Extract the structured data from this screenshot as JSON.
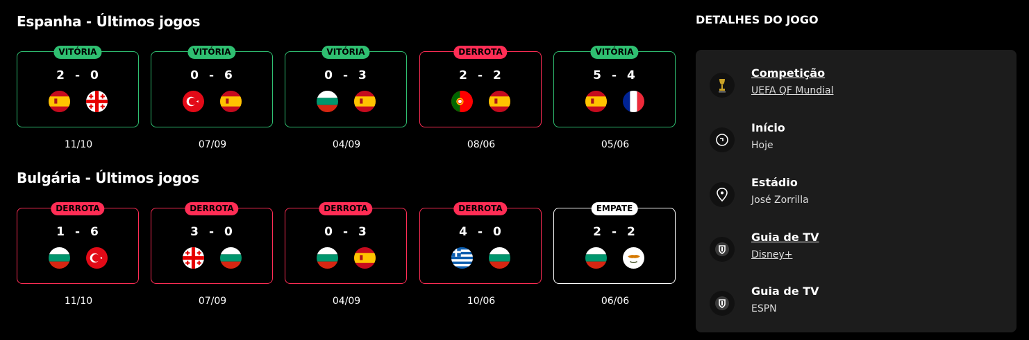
{
  "spain": {
    "title": "Espanha - Últimos jogos",
    "matches": [
      {
        "result": "VITÓRIA",
        "home": "2",
        "away": "0",
        "date": "11/10",
        "home_flag": "spain-flag-icon",
        "away_flag": "georgia-flag-icon"
      },
      {
        "result": "VITÓRIA",
        "home": "0",
        "away": "6",
        "date": "07/09",
        "home_flag": "turkey-flag-icon",
        "away_flag": "spain-flag-icon"
      },
      {
        "result": "VITÓRIA",
        "home": "0",
        "away": "3",
        "date": "04/09",
        "home_flag": "bulgaria-flag-icon",
        "away_flag": "spain-flag-icon"
      },
      {
        "result": "DERROTA",
        "home": "2",
        "away": "2",
        "date": "08/06",
        "home_flag": "portugal-flag-icon",
        "away_flag": "spain-flag-icon"
      },
      {
        "result": "VITÓRIA",
        "home": "5",
        "away": "4",
        "date": "05/06",
        "home_flag": "spain-flag-icon",
        "away_flag": "france-flag-icon"
      }
    ]
  },
  "bulgaria": {
    "title": "Bulgária - Últimos jogos",
    "matches": [
      {
        "result": "DERROTA",
        "home": "1",
        "away": "6",
        "date": "11/10",
        "home_flag": "bulgaria-flag-icon",
        "away_flag": "turkey-flag-icon"
      },
      {
        "result": "DERROTA",
        "home": "3",
        "away": "0",
        "date": "07/09",
        "home_flag": "georgia-flag-icon",
        "away_flag": "bulgaria-flag-icon"
      },
      {
        "result": "DERROTA",
        "home": "0",
        "away": "3",
        "date": "04/09",
        "home_flag": "bulgaria-flag-icon",
        "away_flag": "spain-flag-icon"
      },
      {
        "result": "DERROTA",
        "home": "4",
        "away": "0",
        "date": "10/06",
        "home_flag": "greece-flag-icon",
        "away_flag": "bulgaria-flag-icon"
      },
      {
        "result": "EMPATE",
        "home": "2",
        "away": "2",
        "date": "06/06",
        "home_flag": "bulgaria-flag-icon",
        "away_flag": "cyprus-flag-icon"
      }
    ]
  },
  "details": {
    "title": "DETALHES DO JOGO",
    "items": [
      {
        "label": "Competição",
        "value": "UEFA QF Mundial",
        "icon": "world-cup-trophy-icon"
      },
      {
        "label": "Início",
        "value": "Hoje",
        "icon": "clock-icon"
      },
      {
        "label": "Estádio",
        "value": "José Zorrilla",
        "icon": "location-pin-icon"
      },
      {
        "label": "Guia de TV",
        "value": "Disney+",
        "icon": "tv-shield-icon"
      },
      {
        "label": "Guia de TV",
        "value": "ESPN",
        "icon": "tv-shield-icon"
      }
    ]
  },
  "colors": {
    "win": "#2fbf71",
    "loss": "#ff2d55",
    "draw": "#ffffff",
    "panel": "#1c1c1c"
  }
}
